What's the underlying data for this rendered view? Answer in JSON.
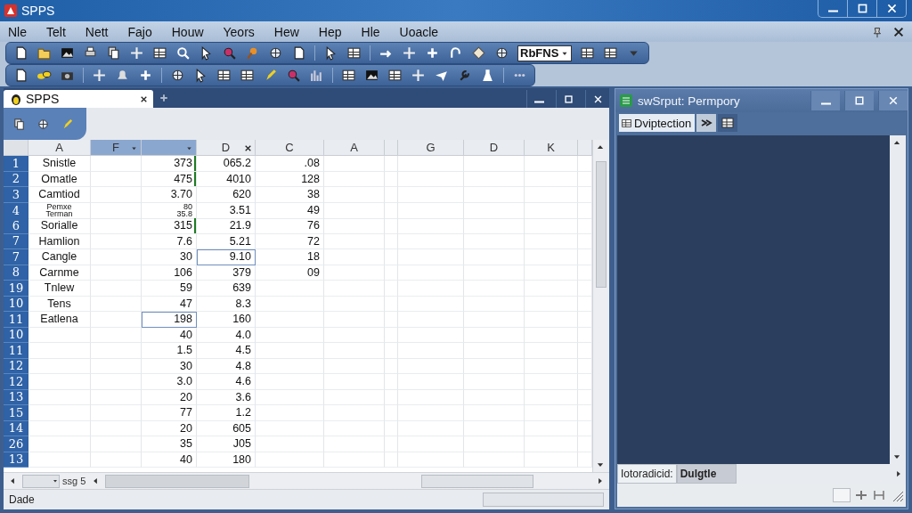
{
  "window": {
    "title": "SPPS"
  },
  "menu": [
    "Nle",
    "Telt",
    "Nett",
    "Fajo",
    "Houw",
    "Yeors",
    "Hew",
    "Hep",
    "Hle",
    "Uoacle"
  ],
  "toolbar": {
    "dropdown": "RbFNS"
  },
  "editor": {
    "tab": {
      "label": "SPPS",
      "selected": true
    },
    "columns": [
      {
        "label": "A",
        "selected": false
      },
      {
        "label": "F",
        "selected": true
      },
      {
        "selected": true
      },
      {
        "label": "D",
        "selected": false
      },
      {
        "label": "C",
        "selected": false
      },
      {
        "label": "A",
        "selected": false
      },
      {
        "label": "G",
        "selected": false
      },
      {
        "label": "D",
        "selected": false
      },
      {
        "label": "K",
        "selected": false
      }
    ],
    "rows": [
      {
        "number": "1",
        "column_1": "Snistle",
        "column_3": "373",
        "column_4": "065.2",
        "column_5": ".08",
        "marked": true,
        "column_3_selected": false,
        "column_4_selected": false
      },
      {
        "number": "2",
        "column_1": "Omatle",
        "column_3": "475",
        "column_4": "4010",
        "column_5": "128",
        "marked": true,
        "column_3_selected": false,
        "column_4_selected": false
      },
      {
        "number": "3",
        "column_1": "Camtiod",
        "column_3": "3.70",
        "column_4": "620",
        "column_5": "38",
        "marked": false,
        "column_3_selected": false,
        "column_4_selected": false
      },
      {
        "number": "4",
        "column_1": "Pemxe\nTerman",
        "column_3": "80\n35.8",
        "column_4": "3.51",
        "column_5": "49",
        "marked": false,
        "column_3_selected": false,
        "column_4_selected": false
      },
      {
        "number": "6",
        "column_1": "Sorialle",
        "column_3": "315",
        "column_4": "21.9",
        "column_5": "76",
        "marked": true,
        "column_3_selected": false,
        "column_4_selected": false
      },
      {
        "number": "7",
        "column_1": "Hamlion",
        "column_3": "7.6",
        "column_4": "5.21",
        "column_5": "72",
        "marked": false,
        "column_3_selected": false,
        "column_4_selected": false
      },
      {
        "number": "7",
        "column_1": "Cangle",
        "column_3": "30",
        "column_4": "9.10",
        "column_5": "18",
        "marked": false,
        "column_3_selected": false,
        "column_4_selected": true
      },
      {
        "number": "8",
        "column_1": "Carnme",
        "column_3": "106",
        "column_4": "379",
        "column_5": "09",
        "marked": false,
        "column_3_selected": false,
        "column_4_selected": false
      },
      {
        "number": "19",
        "column_1": "Tnlew",
        "column_3": "59",
        "column_4": "639",
        "marked": false,
        "column_3_selected": false,
        "column_4_selected": false
      },
      {
        "number": "10",
        "column_1": "Tens",
        "column_3": "47",
        "column_4": "8.3",
        "marked": false,
        "column_3_selected": false,
        "column_4_selected": false
      },
      {
        "number": "11",
        "column_1": "Eatlena",
        "column_3": "198",
        "column_4": "160",
        "marked": false,
        "column_3_selected": true,
        "column_4_selected": false
      },
      {
        "number": "10",
        "column_3": "40",
        "column_4": "4.0",
        "marked": false,
        "column_3_selected": false,
        "column_4_selected": false
      },
      {
        "number": "11",
        "column_3": "1.5",
        "column_4": "4.5",
        "marked": false,
        "column_3_selected": false,
        "column_4_selected": false
      },
      {
        "number": "12",
        "column_3": "30",
        "column_4": "4.8",
        "marked": false,
        "column_3_selected": false,
        "column_4_selected": false
      },
      {
        "number": "12",
        "column_3": "3.0",
        "column_4": "4.6",
        "marked": false,
        "column_3_selected": false,
        "column_4_selected": false
      },
      {
        "number": "13",
        "column_3": "20",
        "column_4": "3.6",
        "marked": false,
        "column_3_selected": false,
        "column_4_selected": false
      },
      {
        "number": "15",
        "column_3": "77",
        "column_4": "1.2",
        "marked": false,
        "column_3_selected": false,
        "column_4_selected": false
      },
      {
        "number": "14",
        "column_3": "20",
        "column_4": "605",
        "marked": false,
        "column_3_selected": false,
        "column_4_selected": false
      },
      {
        "number": "26",
        "column_3": "35",
        "column_4": "J05",
        "marked": false,
        "column_3_selected": false,
        "column_4_selected": false
      },
      {
        "number": "13",
        "column_3": "40",
        "column_4": "180",
        "marked": false,
        "column_3_selected": false,
        "column_4_selected": false
      }
    ],
    "sheet_tab": "ssg 5",
    "status": "Dade"
  },
  "output": {
    "title": "swSrput: Permpory",
    "tabs": [
      {
        "label": "Dviptection",
        "selected": true
      }
    ],
    "bottom_tabs": [
      {
        "label": "Iotoradicid:",
        "selected": false
      },
      {
        "label": "Dulgtle",
        "selected": true
      }
    ]
  }
}
